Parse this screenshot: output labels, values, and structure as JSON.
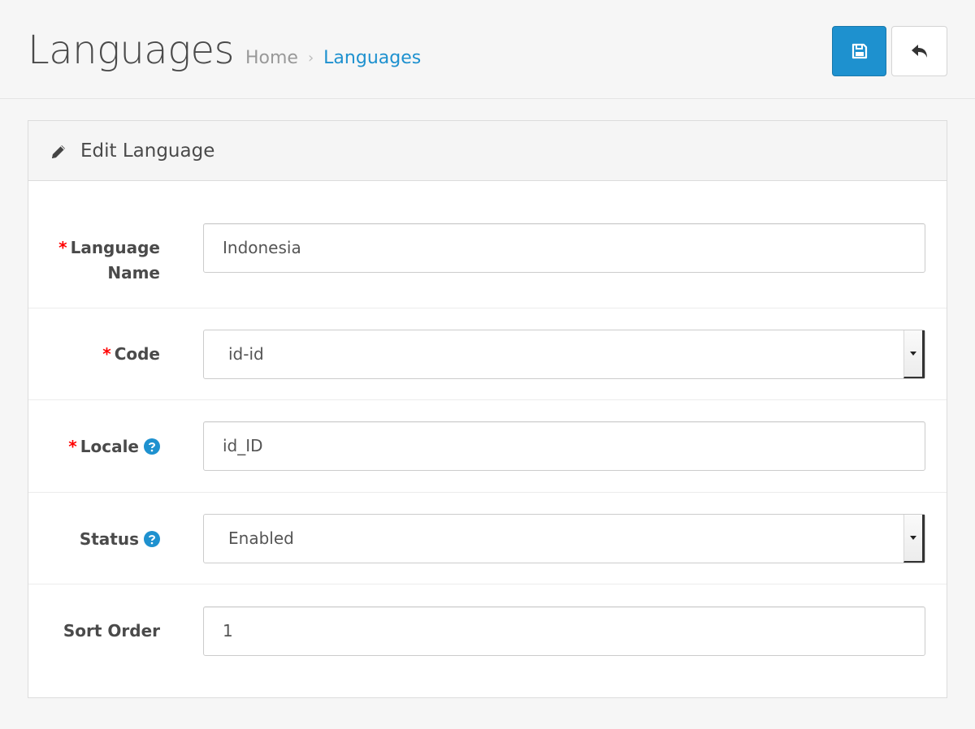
{
  "header": {
    "title": "Languages",
    "breadcrumb": {
      "home": "Home",
      "separator": "›",
      "current": "Languages"
    },
    "buttons": {
      "save_icon": "floppy-disk-icon",
      "back_icon": "reply-arrow-icon"
    }
  },
  "panel": {
    "icon": "pencil-icon",
    "title": "Edit Language"
  },
  "form": {
    "language_name": {
      "label_line1": "Language",
      "label_line2": "Name",
      "required": "*",
      "value": "Indonesia"
    },
    "code": {
      "label": "Code",
      "required": "*",
      "value": "id-id"
    },
    "locale": {
      "label": "Locale",
      "required": "*",
      "help_icon": "question-circle-icon",
      "value": "id_ID"
    },
    "status": {
      "label": "Status",
      "help_icon": "question-circle-icon",
      "value": "Enabled"
    },
    "sort_order": {
      "label": "Sort Order",
      "value": "1"
    }
  },
  "colors": {
    "accent": "#1e91cf",
    "required": "#ff0000"
  }
}
